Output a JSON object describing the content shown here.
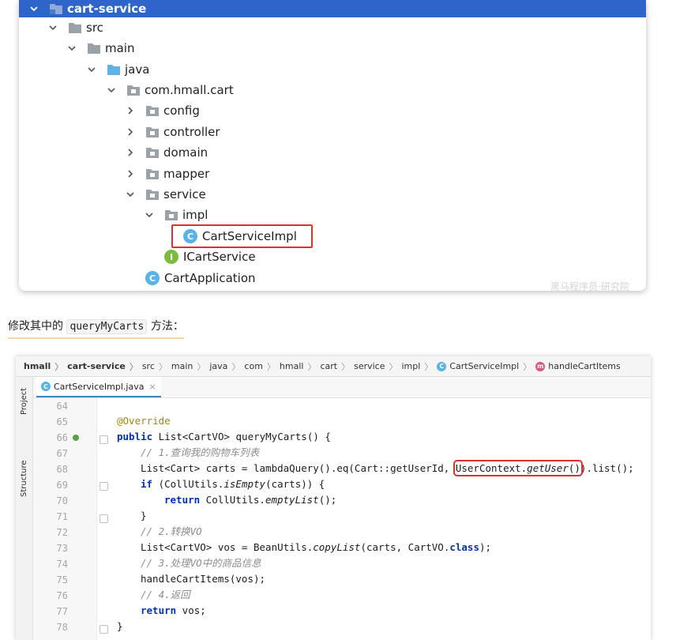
{
  "tree": {
    "root": "cart-service",
    "items": [
      {
        "label": "src",
        "depth": 1,
        "arrow": "down",
        "icon": "folder-grey"
      },
      {
        "label": "main",
        "depth": 2,
        "arrow": "down",
        "icon": "folder-grey"
      },
      {
        "label": "java",
        "depth": 3,
        "arrow": "down",
        "icon": "folder-blue"
      },
      {
        "label": "com.hmall.cart",
        "depth": 4,
        "arrow": "down",
        "icon": "package"
      },
      {
        "label": "config",
        "depth": 5,
        "arrow": "right",
        "icon": "package"
      },
      {
        "label": "controller",
        "depth": 5,
        "arrow": "right",
        "icon": "package"
      },
      {
        "label": "domain",
        "depth": 5,
        "arrow": "right",
        "icon": "package"
      },
      {
        "label": "mapper",
        "depth": 5,
        "arrow": "right",
        "icon": "package"
      },
      {
        "label": "service",
        "depth": 5,
        "arrow": "down",
        "icon": "package"
      },
      {
        "label": "impl",
        "depth": 6,
        "arrow": "down",
        "icon": "package"
      },
      {
        "label": "CartServiceImpl",
        "depth": 7,
        "arrow": "none",
        "icon": "class"
      },
      {
        "label": "ICartService",
        "depth": 6,
        "arrow": "none",
        "icon": "interface"
      },
      {
        "label": "CartApplication",
        "depth": 5,
        "arrow": "none",
        "icon": "app"
      }
    ],
    "class_letter": "C",
    "interface_letter": "I",
    "brand": "黑马程序员·研究院"
  },
  "sentence": {
    "before": "修改其中的",
    "code": "queryMyCarts",
    "after": "方法："
  },
  "breadcrumbs": [
    {
      "label": "hmall",
      "bold": true
    },
    {
      "label": "cart-service",
      "bold": true
    },
    {
      "label": "src"
    },
    {
      "label": "main"
    },
    {
      "label": "java"
    },
    {
      "label": "com"
    },
    {
      "label": "hmall"
    },
    {
      "label": "cart"
    },
    {
      "label": "service"
    },
    {
      "label": "impl"
    },
    {
      "label": "CartServiceImpl",
      "icon": "class"
    },
    {
      "label": "handleCartItems",
      "icon": "method"
    }
  ],
  "side_tabs": {
    "project": "Project",
    "structure": "Structure"
  },
  "editor_tab": {
    "label": "CartServiceImpl.java",
    "close": "×",
    "icon_letter": "C"
  },
  "method_letter": "m",
  "line_numbers": [
    "64",
    "65",
    "66",
    "67",
    "68",
    "69",
    "70",
    "71",
    "72",
    "73",
    "74",
    "75",
    "76",
    "77",
    "78"
  ],
  "code": {
    "l65": "@Override",
    "l66a": "public",
    "l66b": " List<CartVO> queryMyCarts() {",
    "l67": "// 1.查询我的购物车列表",
    "l68a": "List<Cart> carts = lambdaQuery().eq(Cart::getUserId, ",
    "l68b": "UserContext.",
    "l68c": "getUser",
    "l68d": "()",
    "l68e": ").list();",
    "l69a": "if",
    "l69b": " (CollUtils.",
    "l69c": "isEmpty",
    "l69d": "(carts)) {",
    "l70a": "return",
    "l70b": " CollUtils.",
    "l70c": "emptyList",
    "l70d": "();",
    "l71": "}",
    "l72": "// 2.转换VO",
    "l73a": "List<CartVO> vos = BeanUtils.",
    "l73b": "copyList",
    "l73c": "(carts, CartVO.",
    "l73d": "class",
    "l73e": ");",
    "l74": "// 3.处理VO中的商品信息",
    "l75": "handleCartItems(vos);",
    "l76": "// 4.返回",
    "l77a": "return",
    "l77b": " vos;",
    "l78": "}"
  },
  "colors": {
    "selection": "#2f65ca",
    "highlight_border": "#e0302b",
    "keyword": "#0033b3",
    "annotation": "#9e880d",
    "comment": "#8c8c8c"
  }
}
